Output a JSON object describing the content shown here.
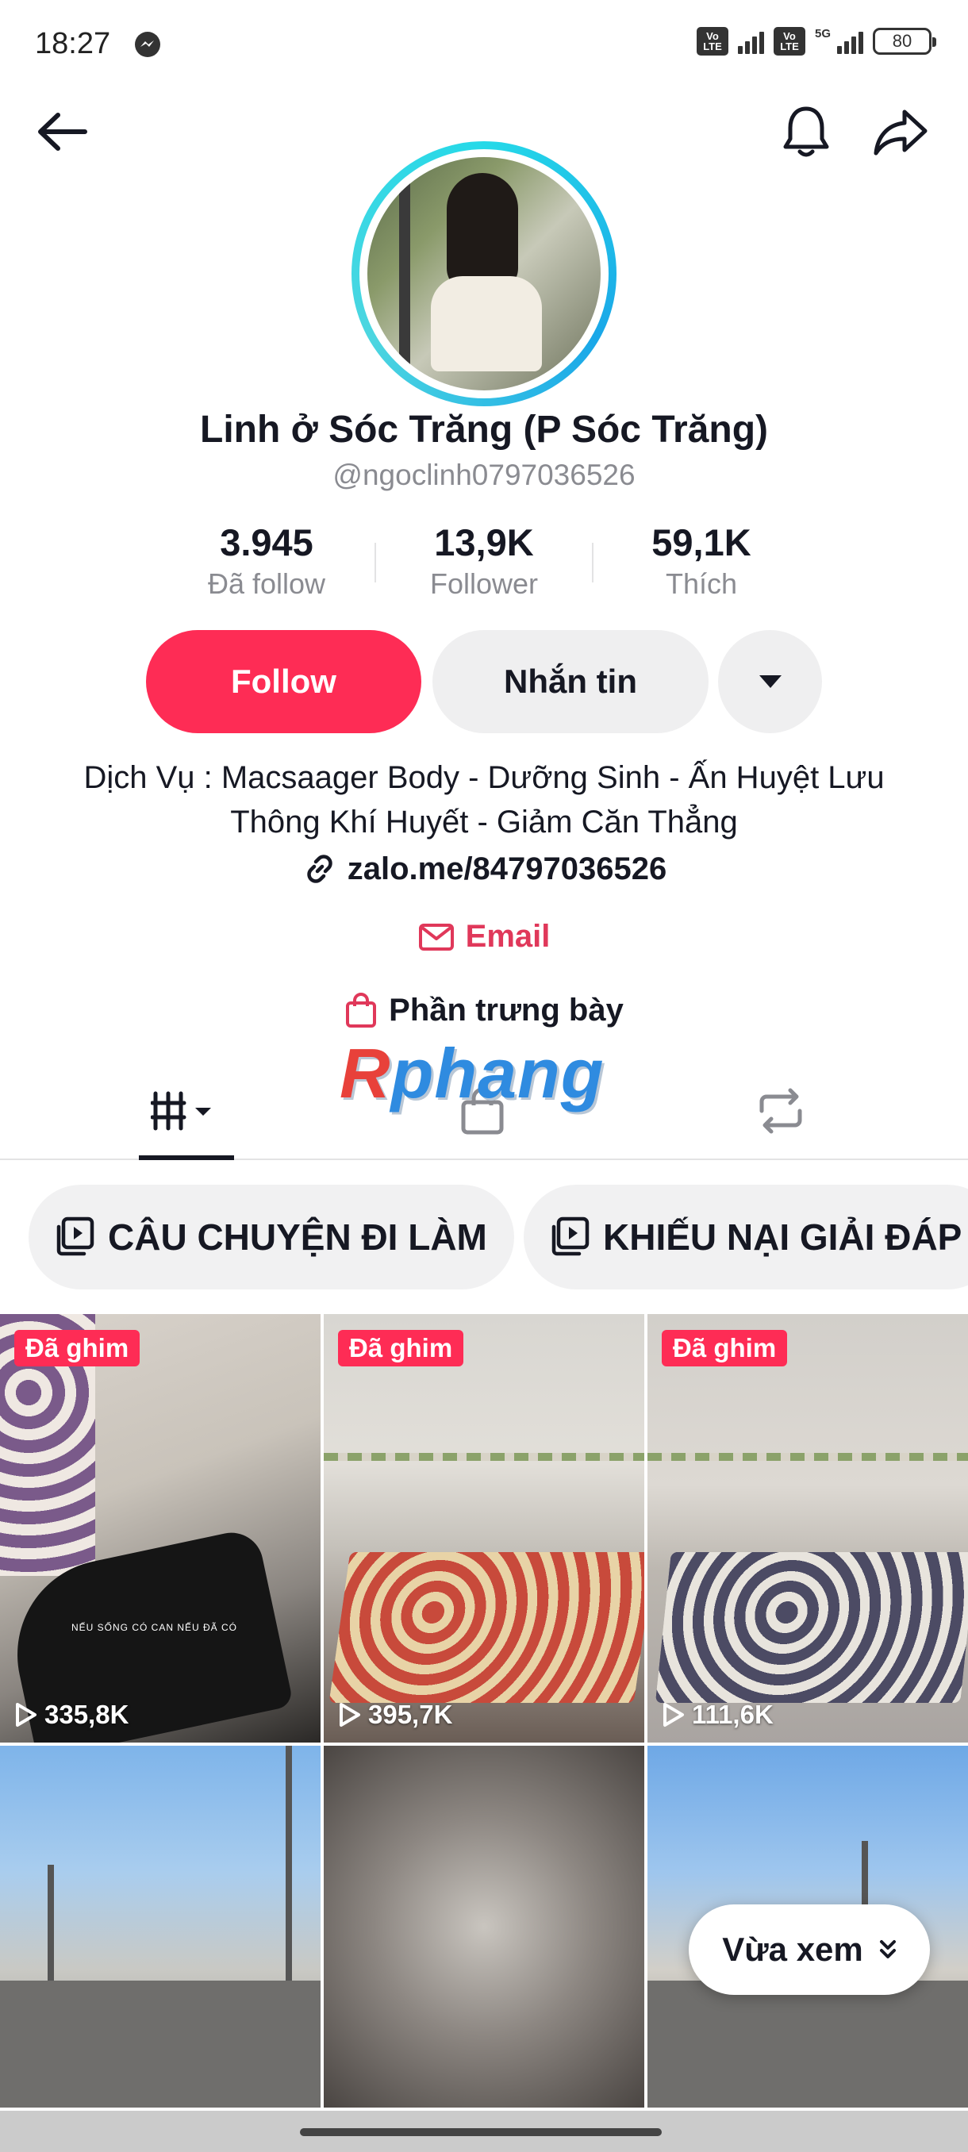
{
  "status_bar": {
    "time": "18:27",
    "volte_1": "Vo LTE",
    "volte_2": "Vo LTE",
    "network": "5G",
    "battery": "80"
  },
  "profile": {
    "display_name": "Linh ở Sóc Trăng (P Sóc Trăng)",
    "username": "@ngoclinh0797036526",
    "avatar_ring_color": "#25d9e8"
  },
  "stats": [
    {
      "value": "3.945",
      "label": "Đã follow"
    },
    {
      "value": "13,9K",
      "label": "Follower"
    },
    {
      "value": "59,1K",
      "label": "Thích"
    }
  ],
  "actions": {
    "follow_label": "Follow",
    "message_label": "Nhắn tin",
    "follow_color": "#fe2c55"
  },
  "bio": {
    "text": "Dịch Vụ : Macsaager Body - Dưỡng Sinh - Ấn Huyệt Lưu Thông Khí Huyết - Giảm Căn Thẳng",
    "link": "zalo.me/84797036526",
    "email_label": "Email",
    "showcase_label": "Phần trưng bày"
  },
  "watermark": {
    "r": "R",
    "rest": "phang"
  },
  "tabs": [
    {
      "icon": "grid-icon",
      "active": true
    },
    {
      "icon": "shopping-bag-icon",
      "active": false
    },
    {
      "icon": "repost-icon",
      "active": false
    }
  ],
  "playlists": [
    {
      "label": "CÂU CHUYỆN ĐI LÀM"
    },
    {
      "label": "KHIẾU NẠI GIẢI ĐÁP"
    }
  ],
  "videos": [
    {
      "pinned_label": "Đã ghim",
      "views": "335,8K",
      "caption": "NẾU SỐNG CÓ CAN NẾU ĐÃ CÓ"
    },
    {
      "pinned_label": "Đã ghim",
      "views": "395,7K"
    },
    {
      "pinned_label": "Đã ghim",
      "views": "111,6K"
    },
    {},
    {},
    {}
  ],
  "recent_button": {
    "label": "Vừa xem"
  }
}
